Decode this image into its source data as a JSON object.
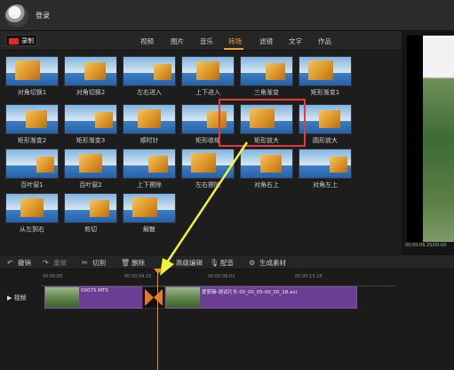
{
  "header": {
    "login_label": "登录"
  },
  "record": {
    "label": "录制"
  },
  "tabs": [
    {
      "label": "视频"
    },
    {
      "label": "图片"
    },
    {
      "label": "音乐"
    },
    {
      "label": "转场",
      "active": true
    },
    {
      "label": "滤镜"
    },
    {
      "label": "文字"
    },
    {
      "label": "作品"
    }
  ],
  "transitions": [
    {
      "label": "对角切换1"
    },
    {
      "label": "对角切换2"
    },
    {
      "label": "左右进入"
    },
    {
      "label": "上下进入"
    },
    {
      "label": "三角渐变"
    },
    {
      "label": "矩形渐变1"
    },
    {
      "label": "矩形渐变2"
    },
    {
      "label": "矩形渐变3"
    },
    {
      "label": "顺时针"
    },
    {
      "label": "矩形收缩"
    },
    {
      "label": "矩形放大",
      "highlighted": true
    },
    {
      "label": "圆形放大"
    },
    {
      "label": "百叶窗1"
    },
    {
      "label": "百叶窗2"
    },
    {
      "label": "上下擦除"
    },
    {
      "label": "左右擦除"
    },
    {
      "label": "对角右上"
    },
    {
      "label": "对角左上"
    },
    {
      "label": "从左到右"
    },
    {
      "label": "剪切"
    },
    {
      "label": "解散"
    }
  ],
  "preview": {
    "timecode": "00:00:06.25/00:00"
  },
  "toolbar": {
    "undo": "撤销",
    "redo": "重做",
    "cut": "切割",
    "delete": "删除",
    "advanced_edit": "高级编辑",
    "dub": "配音",
    "generate": "生成素材"
  },
  "timeline": {
    "ticks": [
      "00:00:00",
      "00:00:04.16",
      "00:00:09.02",
      "00:00:13.18"
    ],
    "track_label": "视频",
    "clip1_name": "00075.MTS",
    "clip2_name": "爱剪辑-测试片头 00_00_05-00_00_18.avi"
  },
  "colors": {
    "accent": "#f3a22e",
    "highlight_box": "#e23b3b",
    "clip": "#6a3f93",
    "arrow": "#f2f23a"
  }
}
